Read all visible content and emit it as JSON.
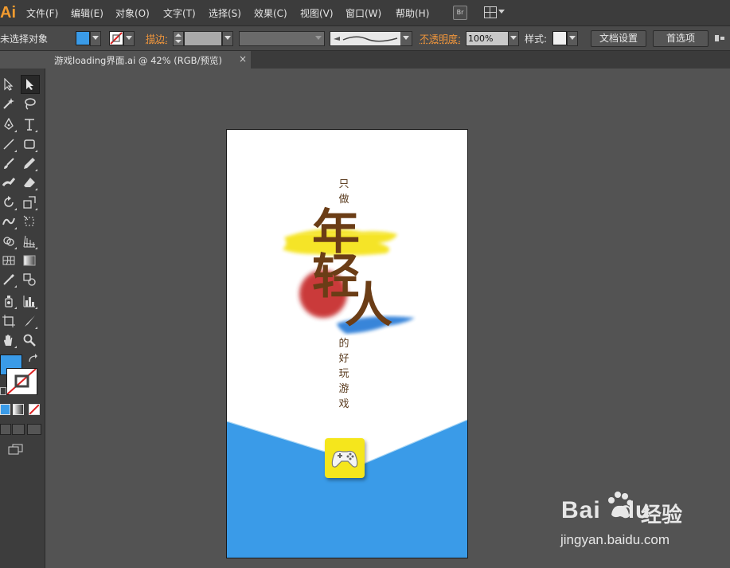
{
  "app": {
    "logo": "Ai",
    "br_label": "Br"
  },
  "menu": [
    "文件(F)",
    "编辑(E)",
    "对象(O)",
    "文字(T)",
    "选择(S)",
    "效果(C)",
    "视图(V)",
    "窗口(W)",
    "帮助(H)"
  ],
  "control_bar": {
    "selection_status": "未选择对象",
    "fill_color": "#3a9be8",
    "stroke_label": "描边:",
    "opacity_label": "不透明度:",
    "opacity_value": "100%",
    "style_label": "样式:",
    "doc_settings_button": "文档设置",
    "preferences_button": "首选项"
  },
  "document_tab": {
    "label": "游戏loading界面.ai @ 42% (RGB/预览)",
    "close": "×"
  },
  "tools": [
    "selection-tool",
    "direct-selection-tool",
    "magic-wand-tool",
    "lasso-tool",
    "pen-tool",
    "type-tool",
    "line-tool",
    "rectangle-tool",
    "paintbrush-tool",
    "pencil-tool",
    "blob-brush-tool",
    "eraser-tool",
    "rotate-tool",
    "scale-tool",
    "warp-tool",
    "free-transform-tool",
    "shape-builder-tool",
    "perspective-grid-tool",
    "mesh-tool",
    "gradient-tool",
    "eyedropper-tool",
    "blend-tool",
    "symbol-sprayer-tool",
    "column-graph-tool",
    "artboard-tool",
    "slice-tool",
    "hand-tool",
    "zoom-tool"
  ],
  "colors": {
    "fill": "#3a9be8",
    "accent_orange": "#f0963c",
    "brush_yellow": "#f5e31a",
    "brush_red": "#c62a2a",
    "brush_blue": "#2f7fd8",
    "bottom_blue": "#3a9be8",
    "text_brown": "#6b3d16"
  },
  "artwork": {
    "top_text": [
      "只",
      "做"
    ],
    "title_chars": [
      "年",
      "轻",
      "人"
    ],
    "bottom_text": [
      "的",
      "好",
      "玩",
      "游",
      "戏"
    ],
    "game_icon": "gamepad-icon"
  },
  "watermark": {
    "logo": "Bai",
    "logo_suffix": "du",
    "brand": "经验",
    "url": "jingyan.baidu.com"
  }
}
